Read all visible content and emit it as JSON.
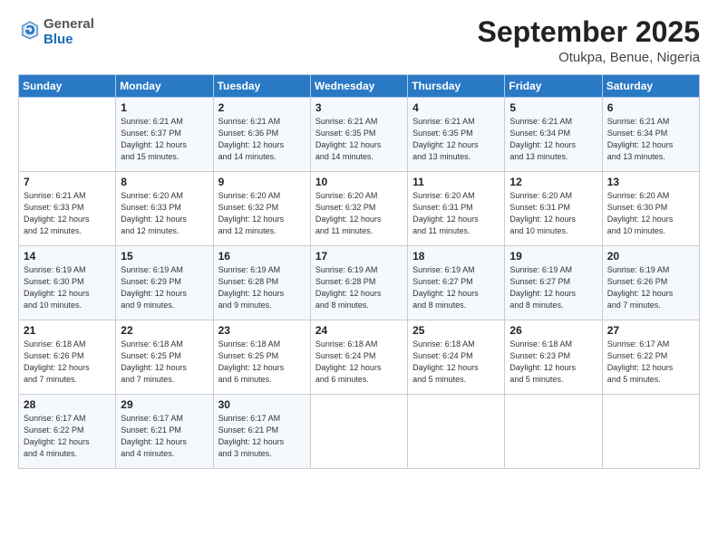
{
  "header": {
    "logo_general": "General",
    "logo_blue": "Blue",
    "month": "September 2025",
    "location": "Otukpa, Benue, Nigeria"
  },
  "days_of_week": [
    "Sunday",
    "Monday",
    "Tuesday",
    "Wednesday",
    "Thursday",
    "Friday",
    "Saturday"
  ],
  "weeks": [
    [
      {
        "num": "",
        "detail": ""
      },
      {
        "num": "1",
        "detail": "Sunrise: 6:21 AM\nSunset: 6:37 PM\nDaylight: 12 hours\nand 15 minutes."
      },
      {
        "num": "2",
        "detail": "Sunrise: 6:21 AM\nSunset: 6:36 PM\nDaylight: 12 hours\nand 14 minutes."
      },
      {
        "num": "3",
        "detail": "Sunrise: 6:21 AM\nSunset: 6:35 PM\nDaylight: 12 hours\nand 14 minutes."
      },
      {
        "num": "4",
        "detail": "Sunrise: 6:21 AM\nSunset: 6:35 PM\nDaylight: 12 hours\nand 13 minutes."
      },
      {
        "num": "5",
        "detail": "Sunrise: 6:21 AM\nSunset: 6:34 PM\nDaylight: 12 hours\nand 13 minutes."
      },
      {
        "num": "6",
        "detail": "Sunrise: 6:21 AM\nSunset: 6:34 PM\nDaylight: 12 hours\nand 13 minutes."
      }
    ],
    [
      {
        "num": "7",
        "detail": "Sunrise: 6:21 AM\nSunset: 6:33 PM\nDaylight: 12 hours\nand 12 minutes."
      },
      {
        "num": "8",
        "detail": "Sunrise: 6:20 AM\nSunset: 6:33 PM\nDaylight: 12 hours\nand 12 minutes."
      },
      {
        "num": "9",
        "detail": "Sunrise: 6:20 AM\nSunset: 6:32 PM\nDaylight: 12 hours\nand 12 minutes."
      },
      {
        "num": "10",
        "detail": "Sunrise: 6:20 AM\nSunset: 6:32 PM\nDaylight: 12 hours\nand 11 minutes."
      },
      {
        "num": "11",
        "detail": "Sunrise: 6:20 AM\nSunset: 6:31 PM\nDaylight: 12 hours\nand 11 minutes."
      },
      {
        "num": "12",
        "detail": "Sunrise: 6:20 AM\nSunset: 6:31 PM\nDaylight: 12 hours\nand 10 minutes."
      },
      {
        "num": "13",
        "detail": "Sunrise: 6:20 AM\nSunset: 6:30 PM\nDaylight: 12 hours\nand 10 minutes."
      }
    ],
    [
      {
        "num": "14",
        "detail": "Sunrise: 6:19 AM\nSunset: 6:30 PM\nDaylight: 12 hours\nand 10 minutes."
      },
      {
        "num": "15",
        "detail": "Sunrise: 6:19 AM\nSunset: 6:29 PM\nDaylight: 12 hours\nand 9 minutes."
      },
      {
        "num": "16",
        "detail": "Sunrise: 6:19 AM\nSunset: 6:28 PM\nDaylight: 12 hours\nand 9 minutes."
      },
      {
        "num": "17",
        "detail": "Sunrise: 6:19 AM\nSunset: 6:28 PM\nDaylight: 12 hours\nand 8 minutes."
      },
      {
        "num": "18",
        "detail": "Sunrise: 6:19 AM\nSunset: 6:27 PM\nDaylight: 12 hours\nand 8 minutes."
      },
      {
        "num": "19",
        "detail": "Sunrise: 6:19 AM\nSunset: 6:27 PM\nDaylight: 12 hours\nand 8 minutes."
      },
      {
        "num": "20",
        "detail": "Sunrise: 6:19 AM\nSunset: 6:26 PM\nDaylight: 12 hours\nand 7 minutes."
      }
    ],
    [
      {
        "num": "21",
        "detail": "Sunrise: 6:18 AM\nSunset: 6:26 PM\nDaylight: 12 hours\nand 7 minutes."
      },
      {
        "num": "22",
        "detail": "Sunrise: 6:18 AM\nSunset: 6:25 PM\nDaylight: 12 hours\nand 7 minutes."
      },
      {
        "num": "23",
        "detail": "Sunrise: 6:18 AM\nSunset: 6:25 PM\nDaylight: 12 hours\nand 6 minutes."
      },
      {
        "num": "24",
        "detail": "Sunrise: 6:18 AM\nSunset: 6:24 PM\nDaylight: 12 hours\nand 6 minutes."
      },
      {
        "num": "25",
        "detail": "Sunrise: 6:18 AM\nSunset: 6:24 PM\nDaylight: 12 hours\nand 5 minutes."
      },
      {
        "num": "26",
        "detail": "Sunrise: 6:18 AM\nSunset: 6:23 PM\nDaylight: 12 hours\nand 5 minutes."
      },
      {
        "num": "27",
        "detail": "Sunrise: 6:17 AM\nSunset: 6:22 PM\nDaylight: 12 hours\nand 5 minutes."
      }
    ],
    [
      {
        "num": "28",
        "detail": "Sunrise: 6:17 AM\nSunset: 6:22 PM\nDaylight: 12 hours\nand 4 minutes."
      },
      {
        "num": "29",
        "detail": "Sunrise: 6:17 AM\nSunset: 6:21 PM\nDaylight: 12 hours\nand 4 minutes."
      },
      {
        "num": "30",
        "detail": "Sunrise: 6:17 AM\nSunset: 6:21 PM\nDaylight: 12 hours\nand 3 minutes."
      },
      {
        "num": "",
        "detail": ""
      },
      {
        "num": "",
        "detail": ""
      },
      {
        "num": "",
        "detail": ""
      },
      {
        "num": "",
        "detail": ""
      }
    ]
  ]
}
